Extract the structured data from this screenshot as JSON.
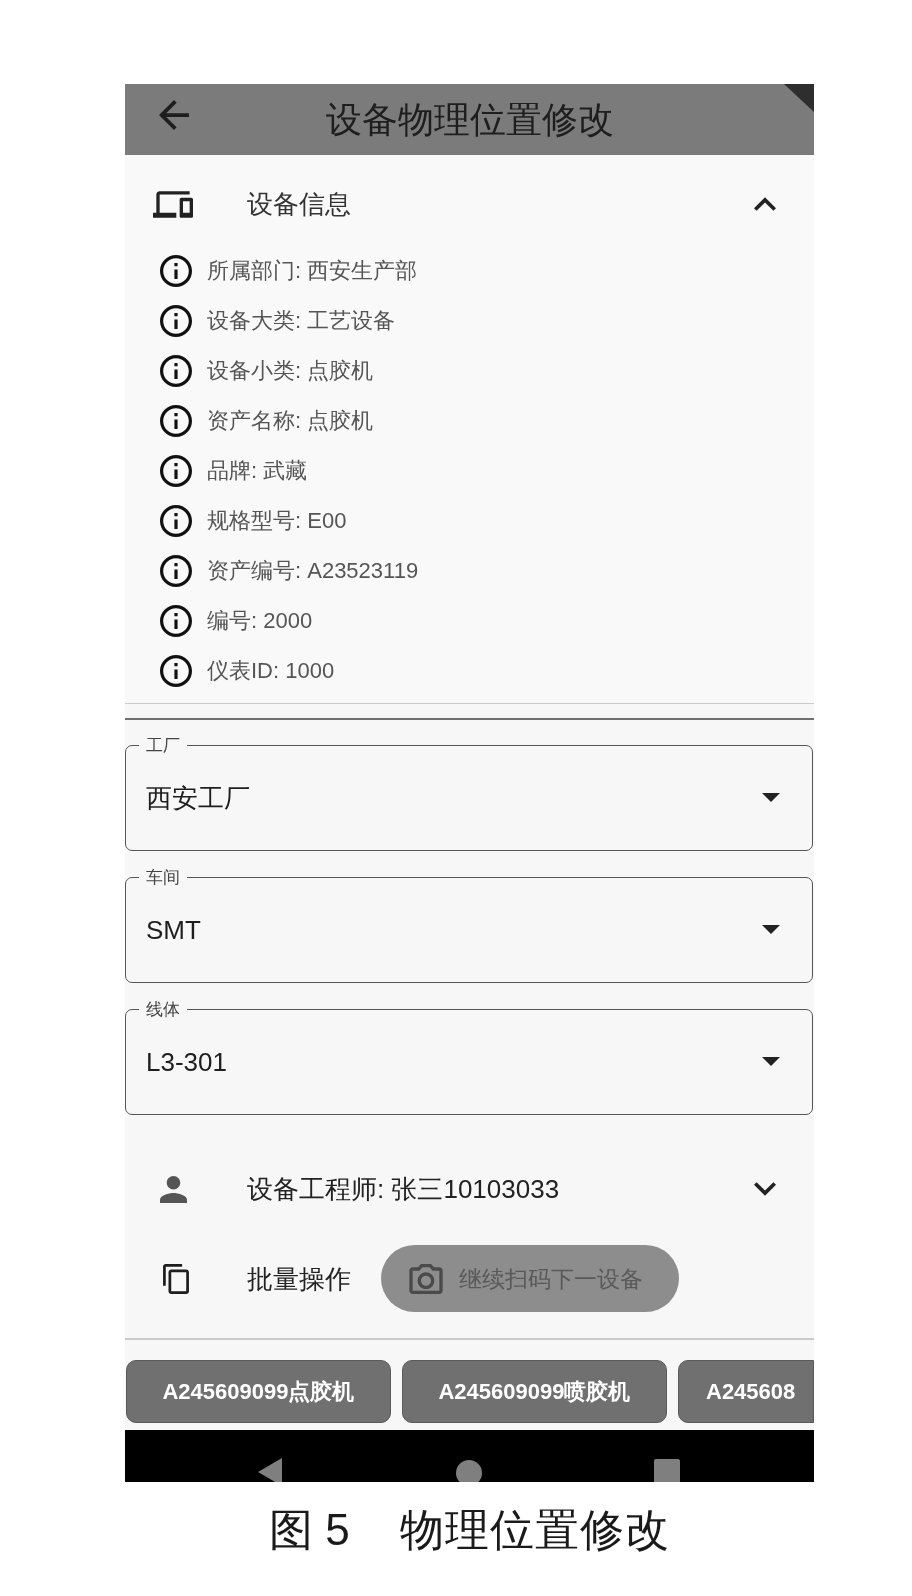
{
  "app_bar": {
    "title": "设备物理位置修改"
  },
  "device_info": {
    "title": "设备信息",
    "expanded": true,
    "items": [
      "所属部门: 西安生产部",
      "设备大类: 工艺设备",
      "设备小类: 点胶机",
      "资产名称: 点胶机",
      "品牌: 武藏",
      "规格型号: E00",
      "资产编号: A23523119",
      "编号: 2000",
      "仪表ID: 1000"
    ]
  },
  "location_fields": [
    {
      "label": "工厂",
      "value": "西安工厂"
    },
    {
      "label": "车间",
      "value": "SMT"
    },
    {
      "label": "线体",
      "value": "L3-301"
    }
  ],
  "engineer": {
    "text": "设备工程师: 张三10103033",
    "expanded": false
  },
  "batch": {
    "label": "批量操作",
    "scan_button": {
      "label": "继续扫码下一设备",
      "disabled": true
    }
  },
  "device_chips": [
    "A245609099点胶机",
    "A245609099喷胶机",
    "A245608"
  ],
  "caption": {
    "number": "图 5",
    "title": "物理位置修改"
  }
}
